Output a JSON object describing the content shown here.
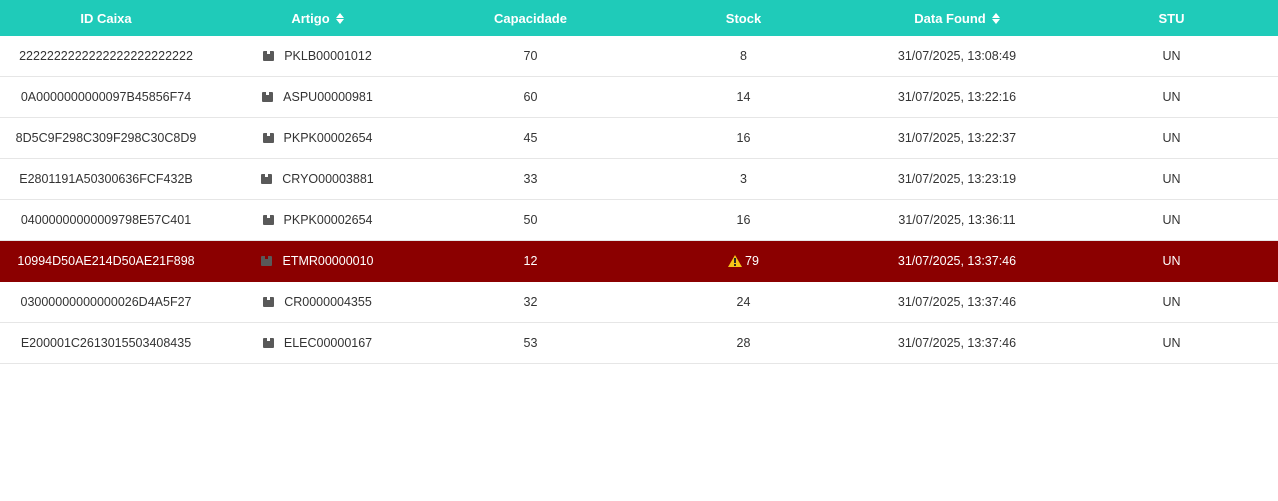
{
  "colors": {
    "header_bg": "#1fcbb9",
    "alert_row_bg": "#8b0000",
    "warning_icon": "#f5c518"
  },
  "table": {
    "headers": {
      "id_caixa": "ID Caixa",
      "artigo": "Artigo",
      "capacidade": "Capacidade",
      "stock": "Stock",
      "data_found": "Data Found",
      "stu": "STU"
    },
    "rows": [
      {
        "id": "2222222222222222222222222",
        "artigo": "PKLB00001012",
        "capacidade": "70",
        "stock": "8",
        "data": "31/07/2025, 13:08:49",
        "stu": "UN",
        "alert": false
      },
      {
        "id": "0A0000000000097B45856F74",
        "artigo": "ASPU00000981",
        "capacidade": "60",
        "stock": "14",
        "data": "31/07/2025, 13:22:16",
        "stu": "UN",
        "alert": false
      },
      {
        "id": "8D5C9F298C309F298C30C8D9",
        "artigo": "PKPK00002654",
        "capacidade": "45",
        "stock": "16",
        "data": "31/07/2025, 13:22:37",
        "stu": "UN",
        "alert": false
      },
      {
        "id": "E2801191A50300636FCF432B",
        "artigo": "CRYO00003881",
        "capacidade": "33",
        "stock": "3",
        "data": "31/07/2025, 13:23:19",
        "stu": "UN",
        "alert": false
      },
      {
        "id": "04000000000009798E57C401",
        "artigo": "PKPK00002654",
        "capacidade": "50",
        "stock": "16",
        "data": "31/07/2025, 13:36:11",
        "stu": "UN",
        "alert": false
      },
      {
        "id": "10994D50AE214D50AE21F898",
        "artigo": "ETMR00000010",
        "capacidade": "12",
        "stock": "79",
        "data": "31/07/2025, 13:37:46",
        "stu": "UN",
        "alert": true
      },
      {
        "id": "03000000000000026D4A5F27",
        "artigo": "CR0000004355",
        "capacidade": "32",
        "stock": "24",
        "data": "31/07/2025, 13:37:46",
        "stu": "UN",
        "alert": false
      },
      {
        "id": "E200001C2613015503408435",
        "artigo": "ELEC00000167",
        "capacidade": "53",
        "stock": "28",
        "data": "31/07/2025, 13:37:46",
        "stu": "UN",
        "alert": false
      }
    ]
  }
}
